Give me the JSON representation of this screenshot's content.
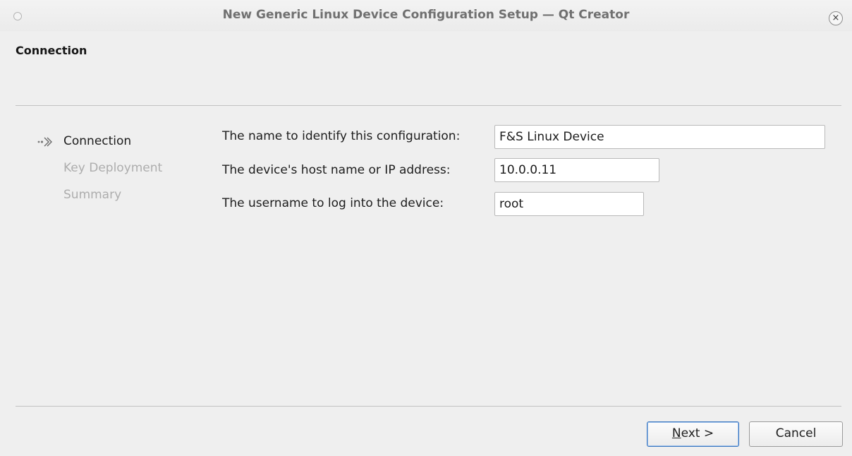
{
  "window": {
    "title": "New Generic Linux Device Configuration Setup — Qt Creator",
    "close_glyph": "×"
  },
  "page": {
    "title": "Connection"
  },
  "steps": [
    {
      "label": "Connection",
      "state": "current",
      "icon": "arrow-right-icon"
    },
    {
      "label": "Key Deployment",
      "state": "pending"
    },
    {
      "label": "Summary",
      "state": "pending"
    }
  ],
  "form": {
    "name": {
      "label": "The name to identify this configuration:",
      "value": "F&S Linux Device"
    },
    "host": {
      "label": "The device's host name or IP address:",
      "value": "10.0.0.11"
    },
    "username": {
      "label": "The username to log into the device:",
      "value": "root"
    }
  },
  "buttons": {
    "next": {
      "mnemonic": "N",
      "rest": "ext >"
    },
    "cancel": {
      "label": "Cancel"
    }
  },
  "colors": {
    "accent": "#3d78c0",
    "inactive_text": "#adadad"
  }
}
